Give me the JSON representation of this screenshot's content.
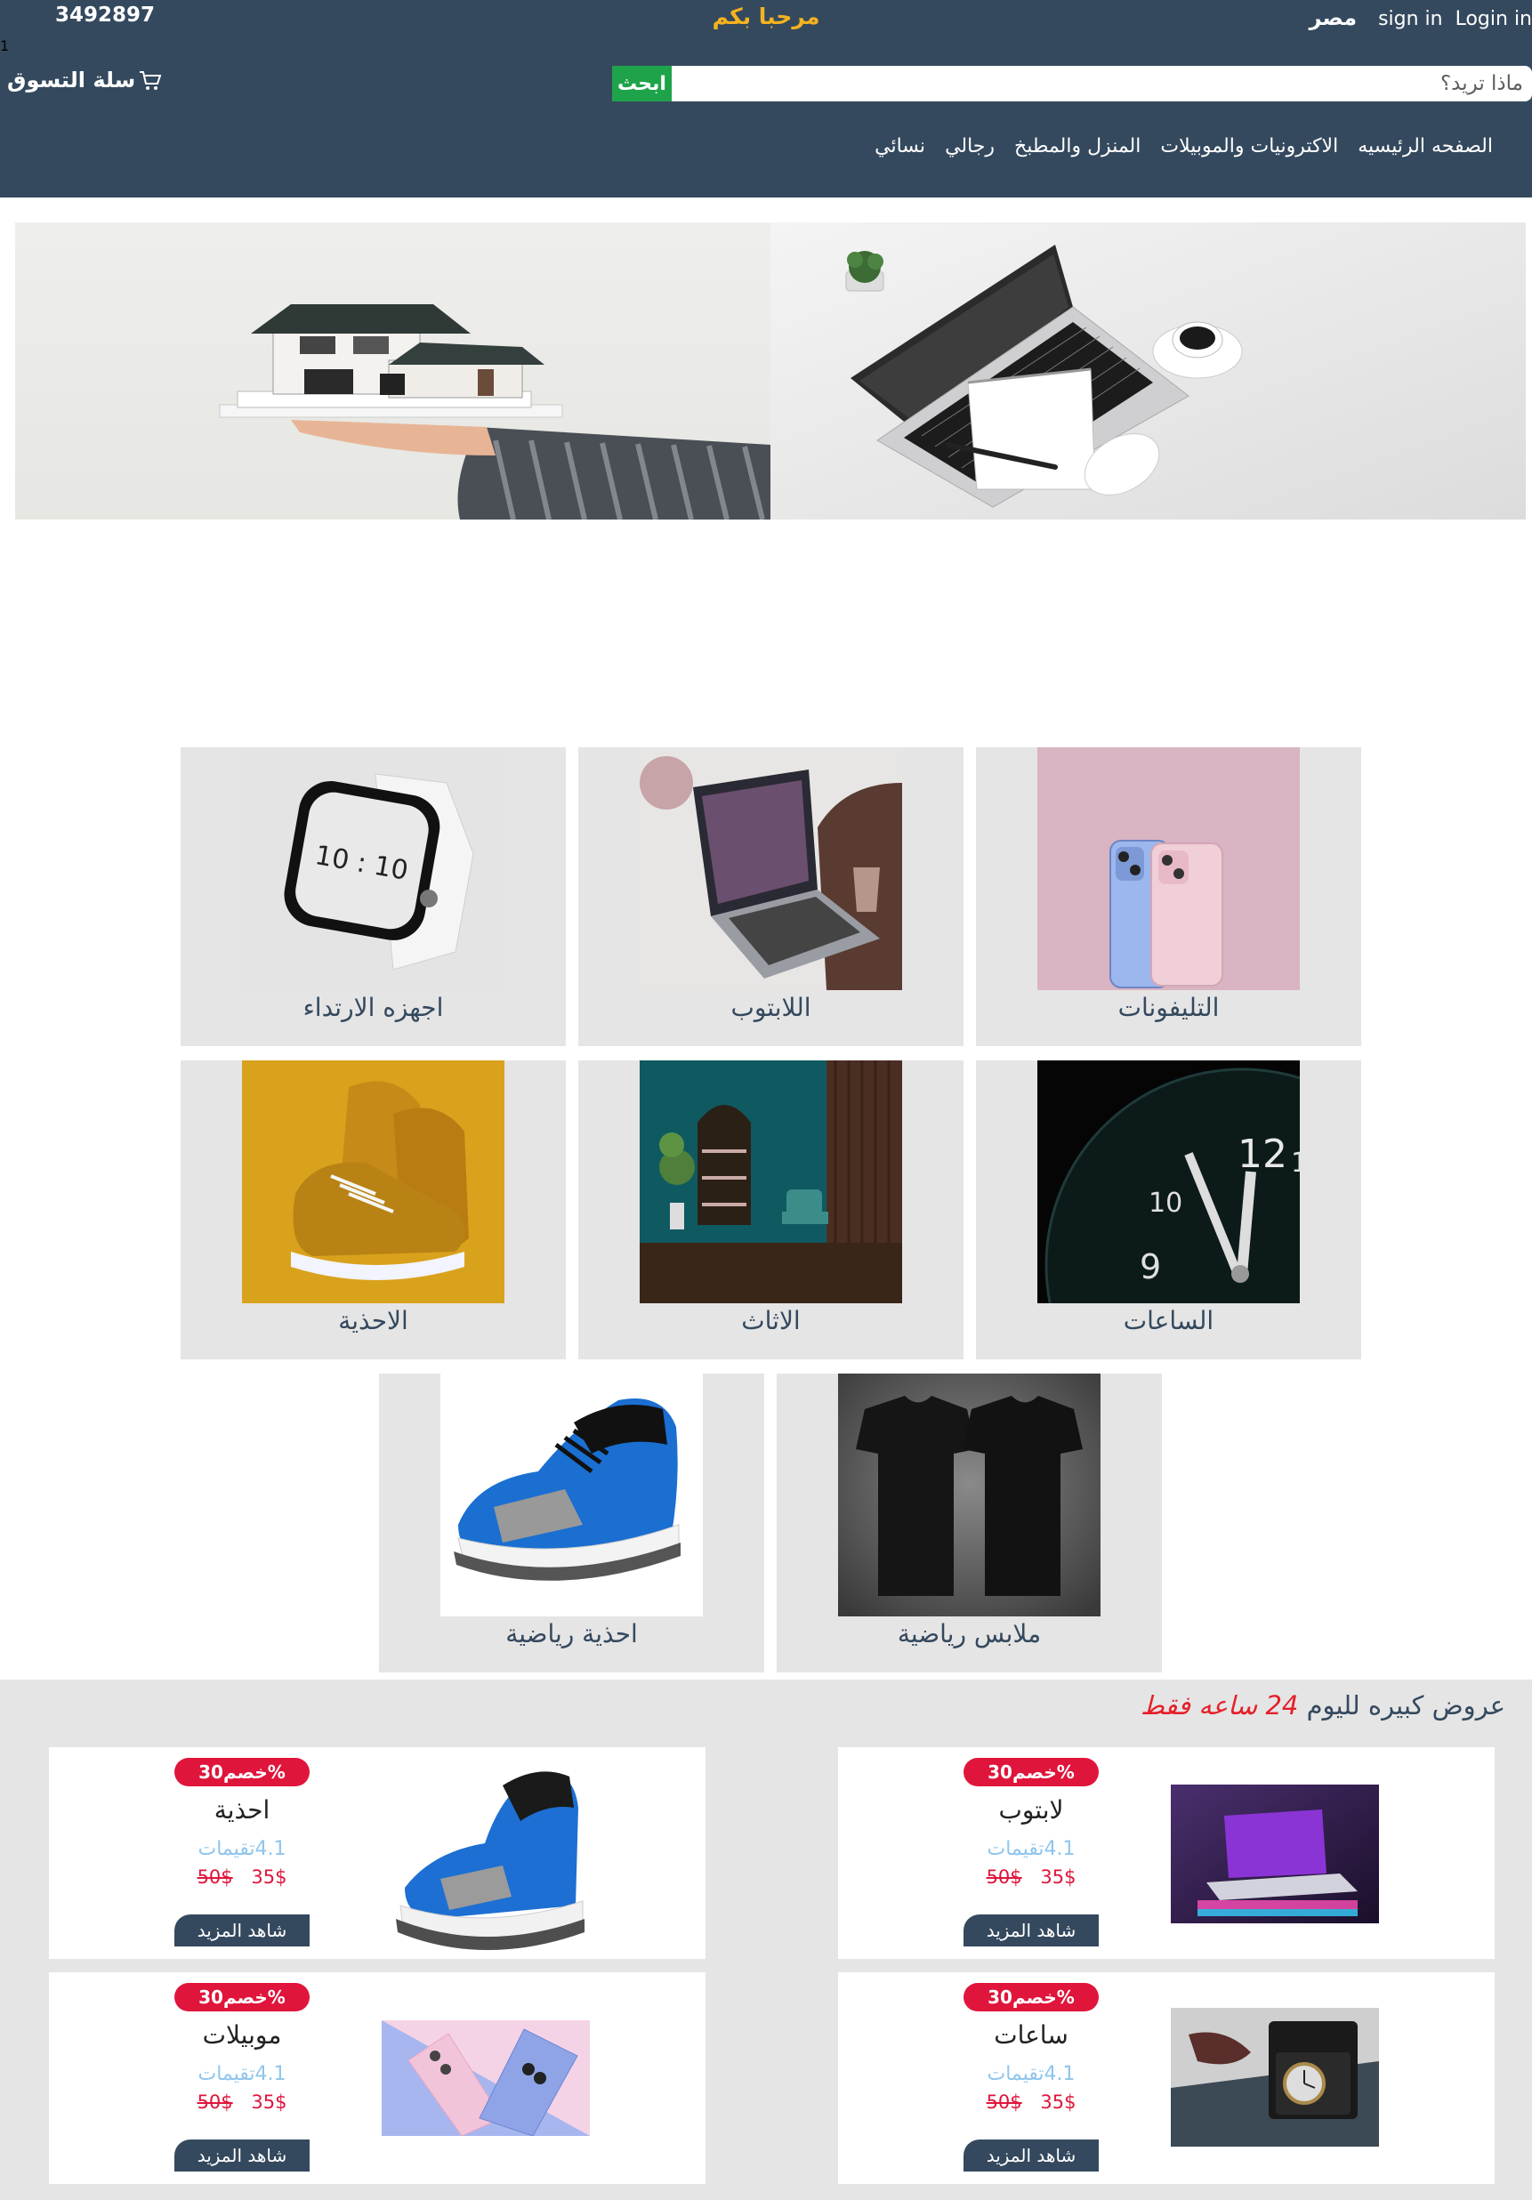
{
  "topbar": {
    "phone": "3492897",
    "welcome": "مرحبا بكم",
    "country": "مصر",
    "sign_in": "sign in",
    "login": "Login in"
  },
  "header": {
    "cart_label": "سلة التسوق",
    "cart_count": "1",
    "search_button": "ابحث",
    "search_placeholder": "ماذا تريد؟",
    "nav": [
      "الصفحه الرئيسيه",
      "الاكترونيات والموبيلات",
      "المنزل والمطبخ",
      "رجالي",
      "نسائي"
    ]
  },
  "categories": [
    {
      "label": "التليفونات",
      "icon": "phones-image"
    },
    {
      "label": "اللابتوب",
      "icon": "laptop-image"
    },
    {
      "label": "اجهزه الارتداء",
      "icon": "smartwatch-image"
    },
    {
      "label": "الساعات",
      "icon": "clock-image"
    },
    {
      "label": "الاثاث",
      "icon": "furniture-image"
    },
    {
      "label": "الاحذية",
      "icon": "shoes-image"
    },
    {
      "label": "ملابس رياضية",
      "icon": "tshirts-image"
    },
    {
      "label": "احذية رياضية",
      "icon": "sneaker-image"
    }
  ],
  "offers": {
    "title_main": "عروض كبيره لليوم",
    "title_highlight": "24 ساعه فقط",
    "items": [
      {
        "discount": "خصم30%",
        "name": "لابتوب",
        "rating": "4.1تقيمات",
        "price": "35$",
        "old_price": "50$",
        "more": "شاهد المزيد"
      },
      {
        "discount": "خصم30%",
        "name": "احذية",
        "rating": "4.1تقيمات",
        "price": "35$",
        "old_price": "50$",
        "more": "شاهد المزيد"
      },
      {
        "discount": "خصم30%",
        "name": "ساعات",
        "rating": "4.1تقيمات",
        "price": "35$",
        "old_price": "50$",
        "more": "شاهد المزيد"
      },
      {
        "discount": "خصم30%",
        "name": "موبيلات",
        "rating": "4.1تقيمات",
        "price": "35$",
        "old_price": "50$",
        "more": "شاهد المزيد"
      }
    ]
  },
  "colors": {
    "header_bg": "#34495e",
    "accent_yellow": "#f5b21f",
    "search_green": "#1fa34a",
    "discount_red": "#e0153b",
    "section_gray": "#e5e5e5"
  }
}
